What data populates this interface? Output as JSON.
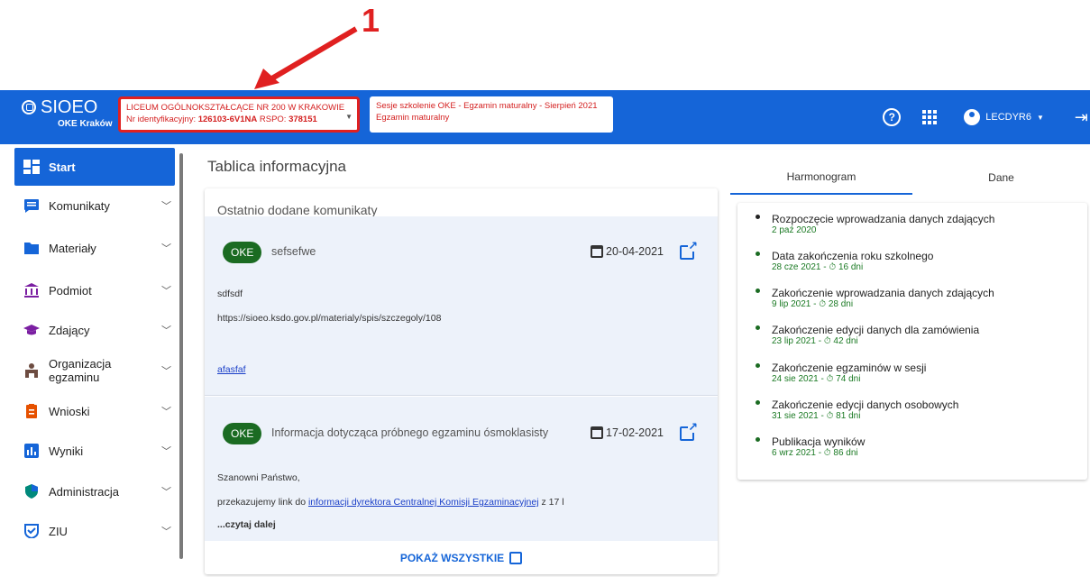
{
  "annotation": {
    "number": "1"
  },
  "header": {
    "logo": {
      "name": "SIOEO",
      "subtitle": "OKE Kraków"
    },
    "school": {
      "name": "LICEUM OGÓLNOKSZTAŁCĄCE NR 200 W KRAKOWIE",
      "id_label": "Nr identyfikacyjny:",
      "id_value": "126103-6V1NA",
      "rspo_label": "RSPO:",
      "rspo_value": "378151"
    },
    "session": {
      "line1": "Sesje szkolenie OKE - Egzamin maturalny - Sierpień 2021",
      "line2": "Egzamin maturalny"
    },
    "user": "LECDYR6",
    "colors": {
      "primary": "#1565d8",
      "highlight": "#e02020"
    }
  },
  "sidebar": {
    "items": [
      {
        "label": "Start",
        "icon": "dashboard-icon"
      },
      {
        "label": "Komunikaty",
        "icon": "message-icon"
      },
      {
        "label": "Materiały",
        "icon": "folder-icon"
      },
      {
        "label": "Podmiot",
        "icon": "institution-icon"
      },
      {
        "label": "Zdający",
        "icon": "graduation-cap-icon"
      },
      {
        "label": "Organizacja egzaminu",
        "icon": "desk-icon"
      },
      {
        "label": "Wnioski",
        "icon": "clipboard-icon"
      },
      {
        "label": "Wyniki",
        "icon": "bar-chart-icon"
      },
      {
        "label": "Administracja",
        "icon": "shield-icon"
      },
      {
        "label": "ZIU",
        "icon": "badge-check-icon"
      }
    ]
  },
  "main": {
    "title": "Tablica informacyjna",
    "card_title": "Ostatnio dodane komunikaty",
    "messages": [
      {
        "badge": "OKE",
        "title": "sefsefwe",
        "date": "20-04-2021",
        "body1": "sdfsdf",
        "body2": "https://sioeo.ksdo.gov.pl/materialy/spis/szczegoly/108",
        "link": "afasfaf"
      },
      {
        "badge": "OKE",
        "title": "Informacja dotycząca próbnego egzaminu ósmoklasisty",
        "date": "17-02-2021",
        "body1": "Szanowni Państwo,",
        "body2_pre": "przekazujemy link do ",
        "body2_link": "informacji dyrektora Centralnej Komisji Egzaminacyjnej",
        "body2_post": " z 17 l",
        "more": "...czytaj dalej"
      }
    ],
    "show_all": "POKAŻ WSZYSTKIE"
  },
  "right": {
    "tabs": [
      "Harmonogram",
      "Dane"
    ],
    "events": [
      {
        "title": "Rozpoczęcie wprowadzania danych zdających",
        "sub": "2 paź 2020"
      },
      {
        "title": "Data zakończenia roku szkolnego",
        "sub": "28 cze 2021 - ⏱ 16 dni"
      },
      {
        "title": "Zakończenie wprowadzania danych zdających",
        "sub": "9 lip 2021 - ⏱ 28 dni"
      },
      {
        "title": "Zakończenie edycji danych dla zamówienia",
        "sub": "23 lip 2021 - ⏱ 42 dni"
      },
      {
        "title": "Zakończenie egzaminów w sesji",
        "sub": "24 sie 2021 - ⏱ 74 dni"
      },
      {
        "title": "Zakończenie edycji danych osobowych",
        "sub": "31 sie 2021 - ⏱ 81 dni"
      },
      {
        "title": "Publikacja wyników",
        "sub": "6 wrz 2021 - ⏱ 86 dni"
      }
    ]
  }
}
